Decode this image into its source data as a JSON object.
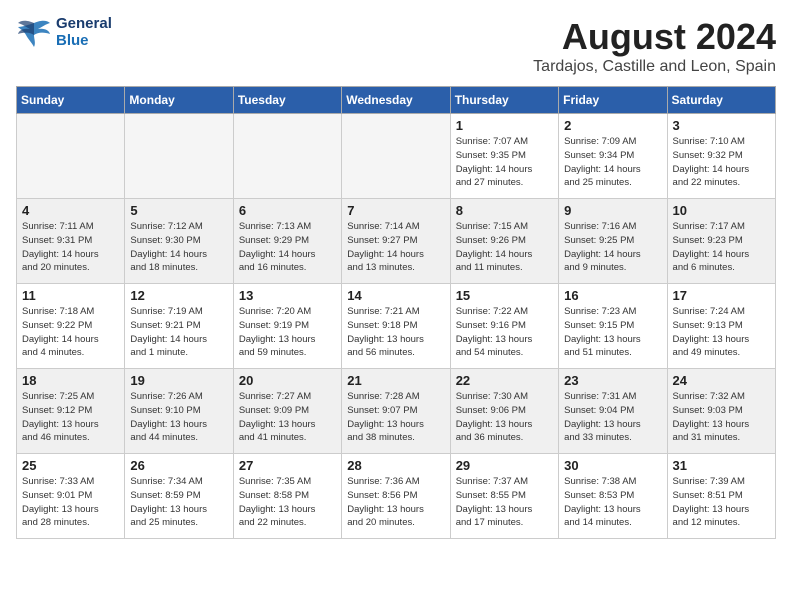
{
  "header": {
    "logo_line1": "General",
    "logo_line2": "Blue",
    "month": "August 2024",
    "location": "Tardajos, Castille and Leon, Spain"
  },
  "weekdays": [
    "Sunday",
    "Monday",
    "Tuesday",
    "Wednesday",
    "Thursday",
    "Friday",
    "Saturday"
  ],
  "weeks": [
    [
      {
        "day": "",
        "info": ""
      },
      {
        "day": "",
        "info": ""
      },
      {
        "day": "",
        "info": ""
      },
      {
        "day": "",
        "info": ""
      },
      {
        "day": "1",
        "info": "Sunrise: 7:07 AM\nSunset: 9:35 PM\nDaylight: 14 hours\nand 27 minutes."
      },
      {
        "day": "2",
        "info": "Sunrise: 7:09 AM\nSunset: 9:34 PM\nDaylight: 14 hours\nand 25 minutes."
      },
      {
        "day": "3",
        "info": "Sunrise: 7:10 AM\nSunset: 9:32 PM\nDaylight: 14 hours\nand 22 minutes."
      }
    ],
    [
      {
        "day": "4",
        "info": "Sunrise: 7:11 AM\nSunset: 9:31 PM\nDaylight: 14 hours\nand 20 minutes."
      },
      {
        "day": "5",
        "info": "Sunrise: 7:12 AM\nSunset: 9:30 PM\nDaylight: 14 hours\nand 18 minutes."
      },
      {
        "day": "6",
        "info": "Sunrise: 7:13 AM\nSunset: 9:29 PM\nDaylight: 14 hours\nand 16 minutes."
      },
      {
        "day": "7",
        "info": "Sunrise: 7:14 AM\nSunset: 9:27 PM\nDaylight: 14 hours\nand 13 minutes."
      },
      {
        "day": "8",
        "info": "Sunrise: 7:15 AM\nSunset: 9:26 PM\nDaylight: 14 hours\nand 11 minutes."
      },
      {
        "day": "9",
        "info": "Sunrise: 7:16 AM\nSunset: 9:25 PM\nDaylight: 14 hours\nand 9 minutes."
      },
      {
        "day": "10",
        "info": "Sunrise: 7:17 AM\nSunset: 9:23 PM\nDaylight: 14 hours\nand 6 minutes."
      }
    ],
    [
      {
        "day": "11",
        "info": "Sunrise: 7:18 AM\nSunset: 9:22 PM\nDaylight: 14 hours\nand 4 minutes."
      },
      {
        "day": "12",
        "info": "Sunrise: 7:19 AM\nSunset: 9:21 PM\nDaylight: 14 hours\nand 1 minute."
      },
      {
        "day": "13",
        "info": "Sunrise: 7:20 AM\nSunset: 9:19 PM\nDaylight: 13 hours\nand 59 minutes."
      },
      {
        "day": "14",
        "info": "Sunrise: 7:21 AM\nSunset: 9:18 PM\nDaylight: 13 hours\nand 56 minutes."
      },
      {
        "day": "15",
        "info": "Sunrise: 7:22 AM\nSunset: 9:16 PM\nDaylight: 13 hours\nand 54 minutes."
      },
      {
        "day": "16",
        "info": "Sunrise: 7:23 AM\nSunset: 9:15 PM\nDaylight: 13 hours\nand 51 minutes."
      },
      {
        "day": "17",
        "info": "Sunrise: 7:24 AM\nSunset: 9:13 PM\nDaylight: 13 hours\nand 49 minutes."
      }
    ],
    [
      {
        "day": "18",
        "info": "Sunrise: 7:25 AM\nSunset: 9:12 PM\nDaylight: 13 hours\nand 46 minutes."
      },
      {
        "day": "19",
        "info": "Sunrise: 7:26 AM\nSunset: 9:10 PM\nDaylight: 13 hours\nand 44 minutes."
      },
      {
        "day": "20",
        "info": "Sunrise: 7:27 AM\nSunset: 9:09 PM\nDaylight: 13 hours\nand 41 minutes."
      },
      {
        "day": "21",
        "info": "Sunrise: 7:28 AM\nSunset: 9:07 PM\nDaylight: 13 hours\nand 38 minutes."
      },
      {
        "day": "22",
        "info": "Sunrise: 7:30 AM\nSunset: 9:06 PM\nDaylight: 13 hours\nand 36 minutes."
      },
      {
        "day": "23",
        "info": "Sunrise: 7:31 AM\nSunset: 9:04 PM\nDaylight: 13 hours\nand 33 minutes."
      },
      {
        "day": "24",
        "info": "Sunrise: 7:32 AM\nSunset: 9:03 PM\nDaylight: 13 hours\nand 31 minutes."
      }
    ],
    [
      {
        "day": "25",
        "info": "Sunrise: 7:33 AM\nSunset: 9:01 PM\nDaylight: 13 hours\nand 28 minutes."
      },
      {
        "day": "26",
        "info": "Sunrise: 7:34 AM\nSunset: 8:59 PM\nDaylight: 13 hours\nand 25 minutes."
      },
      {
        "day": "27",
        "info": "Sunrise: 7:35 AM\nSunset: 8:58 PM\nDaylight: 13 hours\nand 22 minutes."
      },
      {
        "day": "28",
        "info": "Sunrise: 7:36 AM\nSunset: 8:56 PM\nDaylight: 13 hours\nand 20 minutes."
      },
      {
        "day": "29",
        "info": "Sunrise: 7:37 AM\nSunset: 8:55 PM\nDaylight: 13 hours\nand 17 minutes."
      },
      {
        "day": "30",
        "info": "Sunrise: 7:38 AM\nSunset: 8:53 PM\nDaylight: 13 hours\nand 14 minutes."
      },
      {
        "day": "31",
        "info": "Sunrise: 7:39 AM\nSunset: 8:51 PM\nDaylight: 13 hours\nand 12 minutes."
      }
    ]
  ]
}
